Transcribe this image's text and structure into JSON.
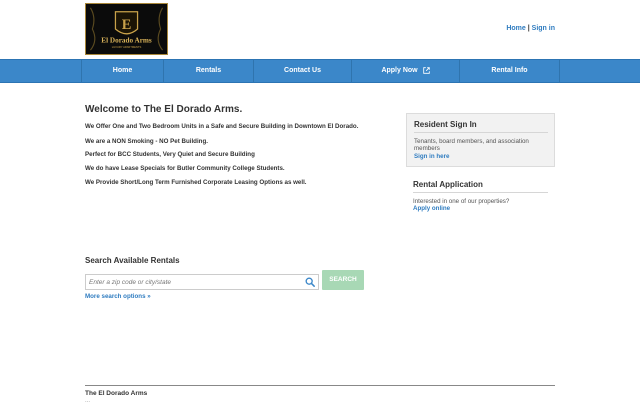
{
  "header": {
    "logo": {
      "text": "El Dorado Arms",
      "tagline": "LUXURY APARTMENTS",
      "emblem_letter": "E"
    },
    "top_links": {
      "home": "Home",
      "separator": "|",
      "sign_in": "Sign in"
    }
  },
  "nav": {
    "items": [
      {
        "label": "Home"
      },
      {
        "label": "Rentals"
      },
      {
        "label": "Contact Us"
      },
      {
        "label": "Apply Now",
        "icon": "external-link-icon"
      },
      {
        "label": "Rental Info"
      }
    ]
  },
  "main": {
    "title": "Welcome to The El Dorado Arms.",
    "paragraphs": [
      "We Offer One and Two Bedroom Units in a Safe and Secure Building in Downtown El Dorado.",
      "We are a NON Smoking - NO Pet Building.",
      "Perfect for BCC Students, Very Quiet and Secure Building",
      "We do have Lease Specials for Butler Community College Students.",
      "We Provide Short/Long Term Furnished Corporate Leasing Options as well."
    ]
  },
  "sidebar": {
    "resident": {
      "title": "Resident Sign In",
      "text": "Tenants, board members, and association members",
      "link": "Sign in here"
    },
    "application": {
      "title": "Rental Application",
      "text": "Interested in one of our properties?",
      "link": "Apply online"
    }
  },
  "search": {
    "title": "Search Available Rentals",
    "placeholder": "Enter a zip code or city/state",
    "value": "",
    "button": "SEARCH",
    "more_link": "More search options »"
  },
  "footer": {
    "name": "The El Dorado Arms",
    "address": "..."
  },
  "colors": {
    "nav_bg": "#3b87c9",
    "link": "#2f7cc0",
    "search_button": "#a8d8b5",
    "logo_gold": "#c9a24a"
  }
}
